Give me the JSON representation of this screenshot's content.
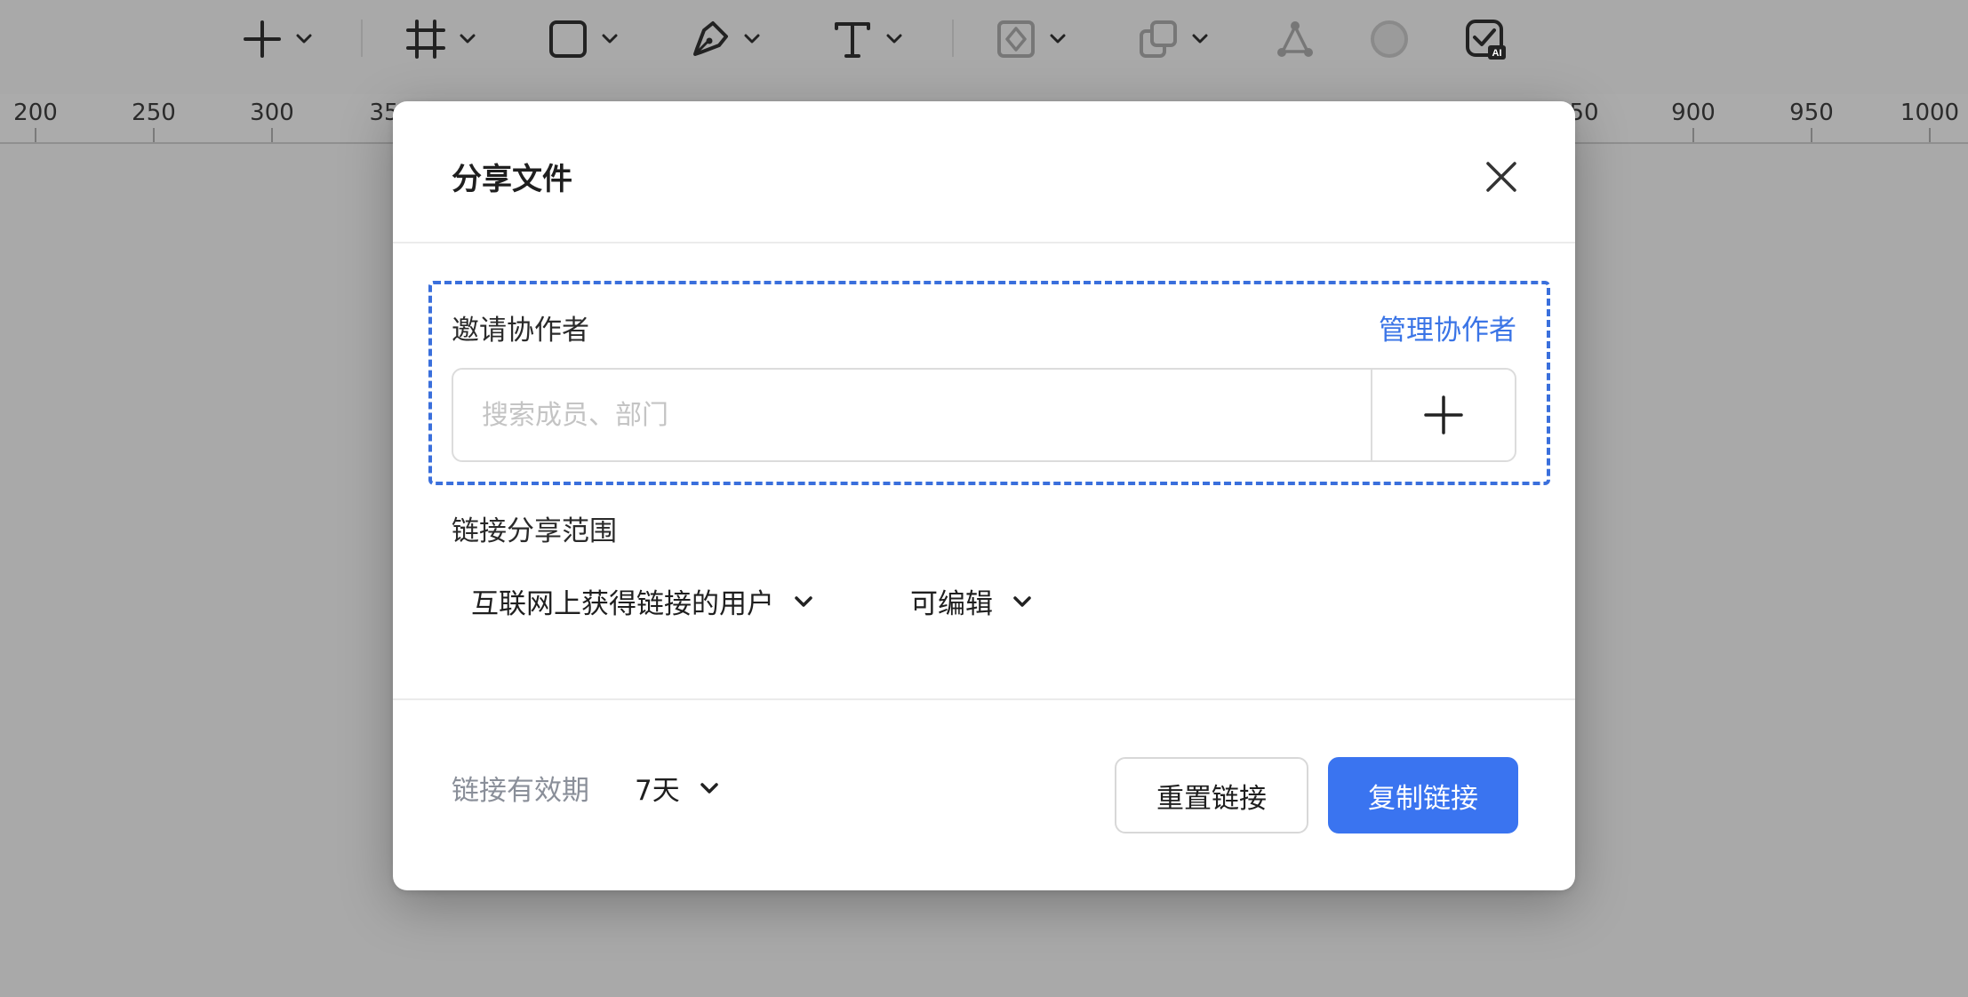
{
  "toolbar": {
    "tools": [
      {
        "name": "add-tool",
        "icon": "plus-icon"
      },
      {
        "name": "frame-tool",
        "icon": "frame-icon"
      },
      {
        "name": "shape-tool",
        "icon": "rectangle-icon"
      },
      {
        "name": "pen-tool",
        "icon": "pen-icon"
      },
      {
        "name": "text-tool",
        "icon": "text-icon"
      },
      {
        "name": "component-tool",
        "icon": "component-icon"
      },
      {
        "name": "boolean-tool",
        "icon": "boolean-icon"
      },
      {
        "name": "vector-network-tool",
        "icon": "vector-network-icon"
      },
      {
        "name": "mask-tool",
        "icon": "circle-icon"
      },
      {
        "name": "ai-tool",
        "icon": "ai-check-icon"
      }
    ]
  },
  "ruler": {
    "labels": [
      "200",
      "250",
      "300",
      "35",
      "50",
      "900",
      "950",
      "1000"
    ]
  },
  "dialog": {
    "title": "分享文件",
    "invite": {
      "label": "邀请协作者",
      "manage_link": "管理协作者",
      "search_placeholder": "搜索成员、部门",
      "search_value": ""
    },
    "scope": {
      "label": "链接分享范围",
      "audience": "互联网上获得链接的用户",
      "permission": "可编辑"
    },
    "footer": {
      "expiry_label": "链接有效期",
      "expiry_value": "7天",
      "reset_button": "重置链接",
      "copy_button": "复制链接"
    }
  },
  "colors": {
    "accent": "#3a74f0",
    "link": "#3a74e6",
    "focus_outline": "#3a6fdc",
    "backdrop": "#a9a9a9"
  }
}
